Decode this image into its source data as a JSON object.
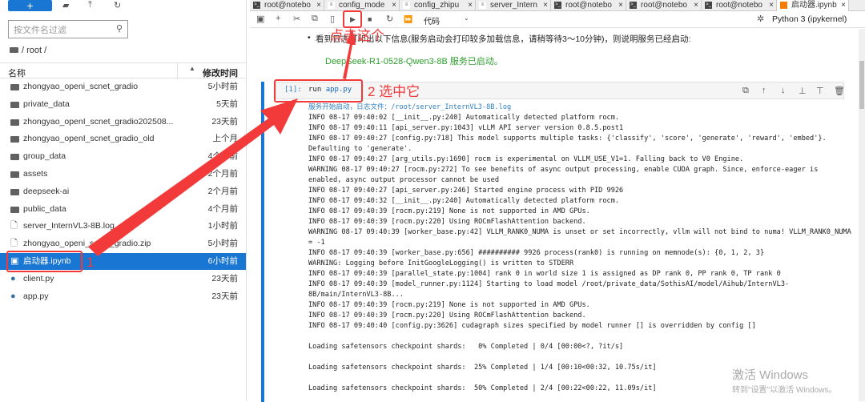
{
  "sidebar": {
    "new_label": "+",
    "filter_placeholder": "按文件名过滤",
    "breadcrumb": "/ root /",
    "col_name": "名称",
    "col_time": "修改时间",
    "files": [
      {
        "name": "zhongyao_openi_scnet_gradio",
        "time": "5小时前",
        "type": "folder"
      },
      {
        "name": "private_data",
        "time": "5天前",
        "type": "folder"
      },
      {
        "name": "zhongyao_openI_scnet_gradio202508...",
        "time": "23天前",
        "type": "folder"
      },
      {
        "name": "zhongyao_openI_scnet_gradio_old",
        "time": "上个月",
        "type": "folder"
      },
      {
        "name": "group_data",
        "time": "4个月前",
        "type": "folder"
      },
      {
        "name": "assets",
        "time": "2个月前",
        "type": "folder"
      },
      {
        "name": "deepseek-ai",
        "time": "2个月前",
        "type": "folder"
      },
      {
        "name": "public_data",
        "time": "4个月前",
        "type": "folder"
      },
      {
        "name": "server_InternVL3-8B.log",
        "time": "1小时前",
        "type": "file"
      },
      {
        "name": "zhongyao_openi_scnet_gradio.zip",
        "time": "5小时前",
        "type": "file"
      },
      {
        "name": "启动器.ipynb",
        "time": "6小时前",
        "type": "notebook",
        "selected": true
      },
      {
        "name": "client.py",
        "time": "23天前",
        "type": "python"
      },
      {
        "name": "app.py",
        "time": "23天前",
        "type": "python"
      }
    ]
  },
  "tabs": [
    "root@notebo",
    "config_mode",
    "config_zhipu",
    "server_Intern",
    "root@notebo",
    "root@notebo",
    "root@notebo",
    "启动器.ipynb"
  ],
  "toolbar": {
    "cell_type": "代码",
    "kernel": "Python 3 (ipykernel)"
  },
  "notebook": {
    "bullet": "看到日志打印出以下信息(服务启动会打印较多加载信息，请稍等待3～10分钟)，则说明服务已经启动:",
    "green": "DeepSeek-R1-0528-Qwen3-8B 服务已启动。",
    "prompt": "[1]:",
    "code_a": "run ",
    "code_b": "app.py",
    "output_head": "服务开始启动，日志文件：/root/server_InternVL3-8B.log",
    "output": "INFO 08-17 09:40:02 [__init__.py:240] Automatically detected platform rocm.\nINFO 08-17 09:40:11 [api_server.py:1043] vLLM API server version 0.8.5.post1\nINFO 08-17 09:40:27 [config.py:718] This model supports multiple tasks: {'classify', 'score', 'generate', 'reward', 'embed'}. Defaulting to 'generate'.\nINFO 08-17 09:40:27 [arg_utils.py:1690] rocm is experimental on VLLM_USE_V1=1. Falling back to V0 Engine.\nWARNING 08-17 09:40:27 [rocm.py:272] To see benefits of async output processing, enable CUDA graph. Since, enforce-eager is enabled, async output processor cannot be used\nINFO 08-17 09:40:27 [api_server.py:246] Started engine process with PID 9926\nINFO 08-17 09:40:32 [__init__.py:240] Automatically detected platform rocm.\nINFO 08-17 09:40:39 [rocm.py:219] None is not supported in AMD GPUs.\nINFO 08-17 09:40:39 [rocm.py:220] Using ROCmFlashAttention backend.\nWARNING 08-17 09:40:39 [worker_base.py:42] VLLM_RANK0_NUMA is unset or set incorrectly, vllm will not bind to numa! VLLM_RANK0_NUMA = -1\nINFO 08-17 09:40:39 [worker_base.py:656] ########## 9926 process(rank0) is running on memnode(s): {0, 1, 2, 3}\nWARNING: Logging before InitGoogleLogging() is written to STDERR\nINFO 08-17 09:40:39 [parallel_state.py:1004] rank 0 in world size 1 is assigned as DP rank 0, PP rank 0, TP rank 0\nINFO 08-17 09:40:39 [model_runner.py:1124] Starting to load model /root/private_data/SothisAI/model/Aihub/InternVL3-8B/main/InternVL3-8B...\nINFO 08-17 09:40:39 [rocm.py:219] None is not supported in AMD GPUs.\nINFO 08-17 09:40:39 [rocm.py:220] Using ROCmFlashAttention backend.\nINFO 08-17 09:40:40 [config.py:3626] cudagraph sizes specified by model runner [] is overridden by config []\n\nLoading safetensors checkpoint shards:   0% Completed | 0/4 [00:00<?, ?it/s]\n\nLoading safetensors checkpoint shards:  25% Completed | 1/4 [00:10<00:32, 10.75s/it]\n\nLoading safetensors checkpoint shards:  50% Completed | 2/4 [00:22<00:22, 11.09s/it]"
  },
  "annotations": {
    "step1": "1",
    "step2": "2 选中它",
    "click": "点击这个"
  },
  "watermark": {
    "line1": "激活 Windows",
    "line2": "转到\"设置\"以激活 Windows。"
  },
  "colors": {
    "accent": "#1976d2",
    "annotation": "#f23a3a",
    "green": "#2e9e2e"
  }
}
